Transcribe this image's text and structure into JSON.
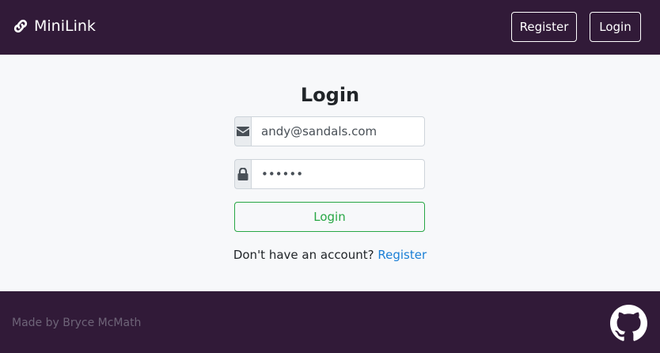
{
  "navbar": {
    "brand": "MiniLink",
    "brand_icon": "link-icon",
    "register_label": "Register",
    "login_label": "Login",
    "background": "#311a38"
  },
  "form": {
    "title": "Login",
    "email": {
      "value": "andy@sandals.com",
      "icon": "envelope-icon"
    },
    "password": {
      "value": "••••••",
      "icon": "lock-icon"
    },
    "submit_label": "Login",
    "prompt_text": "Don't have an account?",
    "register_link": "Register",
    "accent_color": "#28a745",
    "link_color": "#1a7fd6"
  },
  "footer": {
    "credit": "Made by Bryce McMath",
    "github_icon": "github-icon"
  }
}
